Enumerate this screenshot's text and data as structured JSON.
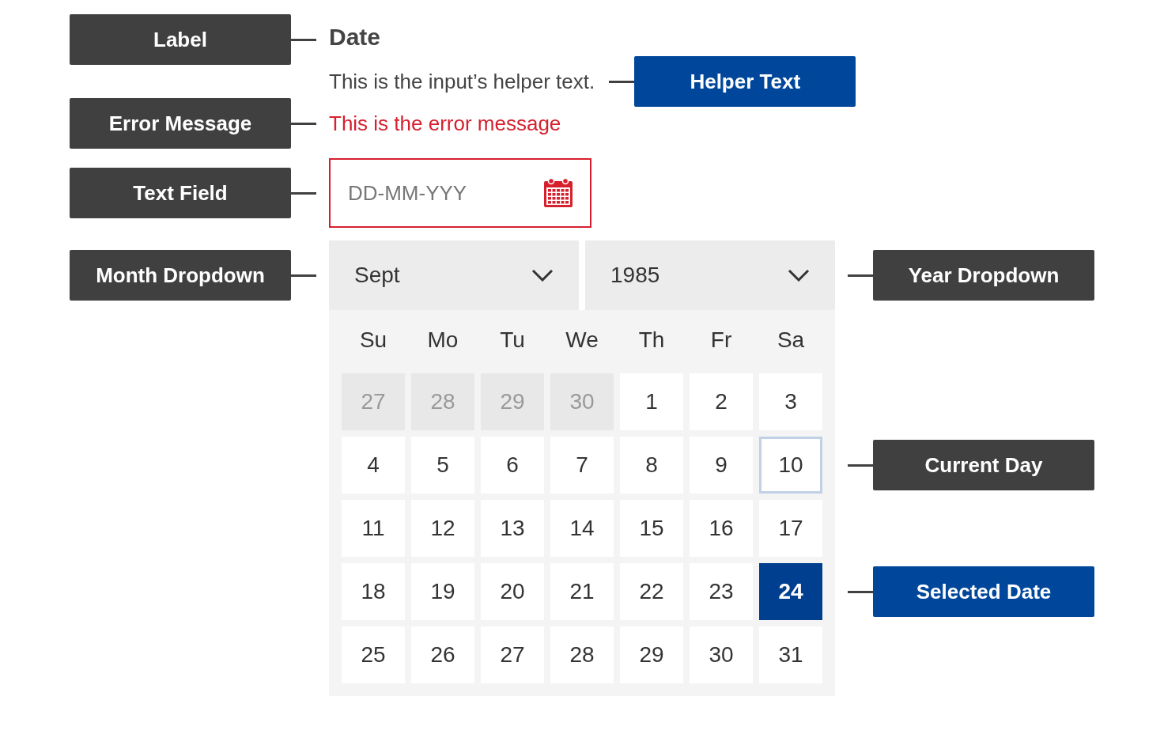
{
  "label": "Date",
  "helper_text": "This is the input’s helper text.",
  "error_message": "This is the error message",
  "text_field": {
    "placeholder": "DD-MM-YYY"
  },
  "month_dropdown": {
    "value": "Sept"
  },
  "year_dropdown": {
    "value": "1985"
  },
  "weekdays": [
    "Su",
    "Mo",
    "Tu",
    "We",
    "Th",
    "Fr",
    "Sa"
  ],
  "days": [
    {
      "day": "27",
      "muted": true,
      "current": false,
      "selected": false
    },
    {
      "day": "28",
      "muted": true,
      "current": false,
      "selected": false
    },
    {
      "day": "29",
      "muted": true,
      "current": false,
      "selected": false
    },
    {
      "day": "30",
      "muted": true,
      "current": false,
      "selected": false
    },
    {
      "day": "1",
      "muted": false,
      "current": false,
      "selected": false
    },
    {
      "day": "2",
      "muted": false,
      "current": false,
      "selected": false
    },
    {
      "day": "3",
      "muted": false,
      "current": false,
      "selected": false
    },
    {
      "day": "4",
      "muted": false,
      "current": false,
      "selected": false
    },
    {
      "day": "5",
      "muted": false,
      "current": false,
      "selected": false
    },
    {
      "day": "6",
      "muted": false,
      "current": false,
      "selected": false
    },
    {
      "day": "7",
      "muted": false,
      "current": false,
      "selected": false
    },
    {
      "day": "8",
      "muted": false,
      "current": false,
      "selected": false
    },
    {
      "day": "9",
      "muted": false,
      "current": false,
      "selected": false
    },
    {
      "day": "10",
      "muted": false,
      "current": true,
      "selected": false
    },
    {
      "day": "11",
      "muted": false,
      "current": false,
      "selected": false
    },
    {
      "day": "12",
      "muted": false,
      "current": false,
      "selected": false
    },
    {
      "day": "13",
      "muted": false,
      "current": false,
      "selected": false
    },
    {
      "day": "14",
      "muted": false,
      "current": false,
      "selected": false
    },
    {
      "day": "15",
      "muted": false,
      "current": false,
      "selected": false
    },
    {
      "day": "16",
      "muted": false,
      "current": false,
      "selected": false
    },
    {
      "day": "17",
      "muted": false,
      "current": false,
      "selected": false
    },
    {
      "day": "18",
      "muted": false,
      "current": false,
      "selected": false
    },
    {
      "day": "19",
      "muted": false,
      "current": false,
      "selected": false
    },
    {
      "day": "20",
      "muted": false,
      "current": false,
      "selected": false
    },
    {
      "day": "21",
      "muted": false,
      "current": false,
      "selected": false
    },
    {
      "day": "22",
      "muted": false,
      "current": false,
      "selected": false
    },
    {
      "day": "23",
      "muted": false,
      "current": false,
      "selected": false
    },
    {
      "day": "24",
      "muted": false,
      "current": false,
      "selected": true
    },
    {
      "day": "25",
      "muted": false,
      "current": false,
      "selected": false
    },
    {
      "day": "26",
      "muted": false,
      "current": false,
      "selected": false
    },
    {
      "day": "27",
      "muted": false,
      "current": false,
      "selected": false
    },
    {
      "day": "28",
      "muted": false,
      "current": false,
      "selected": false
    },
    {
      "day": "29",
      "muted": false,
      "current": false,
      "selected": false
    },
    {
      "day": "30",
      "muted": false,
      "current": false,
      "selected": false
    },
    {
      "day": "31",
      "muted": false,
      "current": false,
      "selected": false
    }
  ],
  "callouts": [
    {
      "kind": "label",
      "text": "Label",
      "color": "#404040"
    },
    {
      "kind": "helper",
      "text": "Helper Text",
      "color": "#00479b"
    },
    {
      "kind": "error",
      "text": "Error Message",
      "color": "#404040"
    },
    {
      "kind": "field",
      "text": "Text Field",
      "color": "#404040"
    },
    {
      "kind": "month",
      "text": "Month Dropdown",
      "color": "#404040"
    },
    {
      "kind": "year",
      "text": "Year Dropdown",
      "color": "#404040"
    },
    {
      "kind": "current",
      "text": "Current Day",
      "color": "#404040"
    },
    {
      "kind": "selected",
      "text": "Selected Date",
      "color": "#00479b"
    }
  ]
}
